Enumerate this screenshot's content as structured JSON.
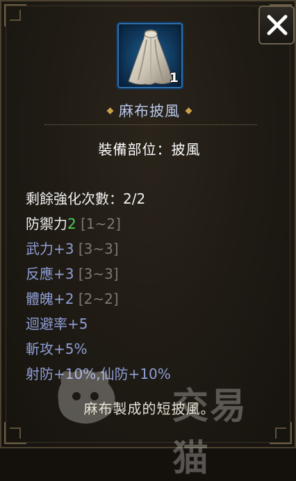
{
  "item": {
    "name": "麻布披風",
    "count": "1",
    "equip_slot": "裝備部位：披風",
    "description": "麻布製成的短披風。"
  },
  "stats": {
    "reinforce": "剩餘強化次數：2/2",
    "defense_label": "防禦力",
    "defense_value": "2",
    "defense_range": " [1~2]",
    "strength": "武力+3",
    "strength_range": " [3~3]",
    "reaction": "反應+3",
    "reaction_range": " [3~3]",
    "physique": "體魄+2",
    "physique_range": " [2~2]",
    "evasion": "迴避率+5",
    "slash_attack": "斬攻+5%",
    "resistances": "射防+10%,仙防+10%"
  },
  "watermark": {
    "text": "交易猫"
  },
  "colors": {
    "name_blue": "#b7c6ea",
    "stat_blue": "#8f9fd6",
    "value_green": "#4fd05a",
    "range_grey": "#7e7a73",
    "gold_diamond": "#c9a24a"
  },
  "icons": {
    "close": "close-x-icon",
    "item": "cloak-icon",
    "watermark": "cat-logo-icon"
  }
}
